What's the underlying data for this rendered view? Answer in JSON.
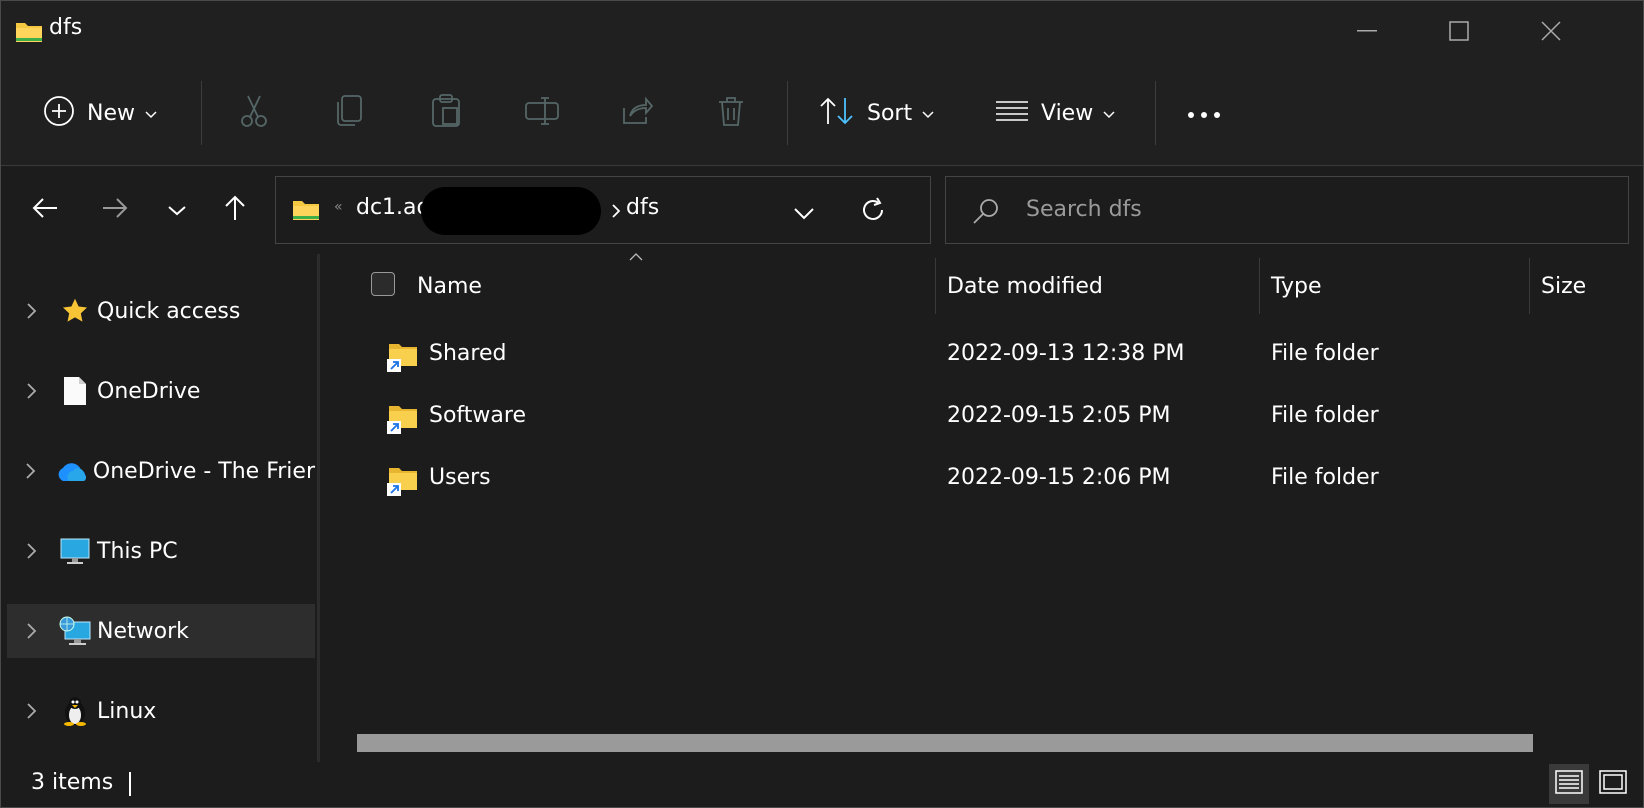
{
  "window": {
    "title": "dfs"
  },
  "toolbar": {
    "new_label": "New",
    "sort_label": "Sort",
    "view_label": "View"
  },
  "address": {
    "segment1": "dc1.ad",
    "segment2": "dfs"
  },
  "search": {
    "placeholder": "Search dfs"
  },
  "sidebar": {
    "items": [
      {
        "label": "Quick access",
        "icon": "star-icon"
      },
      {
        "label": "OneDrive",
        "icon": "document-icon"
      },
      {
        "label": "OneDrive - The Frier",
        "icon": "cloud-icon"
      },
      {
        "label": "This PC",
        "icon": "monitor-icon"
      },
      {
        "label": "Network",
        "icon": "network-icon",
        "selected": true
      },
      {
        "label": "Linux",
        "icon": "penguin-icon"
      }
    ]
  },
  "columns": {
    "name": "Name",
    "date": "Date modified",
    "type": "Type",
    "size": "Size"
  },
  "files": [
    {
      "name": "Shared",
      "date": "2022-09-13 12:38 PM",
      "type": "File folder"
    },
    {
      "name": "Software",
      "date": "2022-09-15 2:05 PM",
      "type": "File folder"
    },
    {
      "name": "Users",
      "date": "2022-09-15 2:06 PM",
      "type": "File folder"
    }
  ],
  "status": {
    "items_count": "3 items"
  },
  "colors": {
    "background": "#1c1c1c",
    "folder": "#f5c842",
    "accent": "#4cc2ff"
  }
}
